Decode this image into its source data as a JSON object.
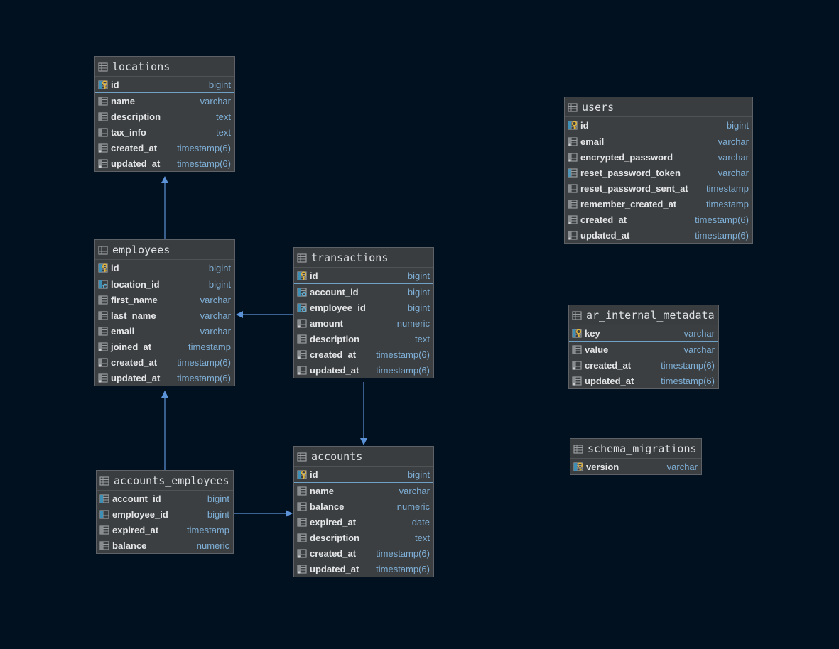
{
  "tables": [
    {
      "key": "locations",
      "name": "locations",
      "columns": [
        {
          "name": "id",
          "type": "bigint",
          "kind": "pk"
        },
        {
          "name": "name",
          "type": "varchar",
          "kind": "col"
        },
        {
          "name": "description",
          "type": "text",
          "kind": "col"
        },
        {
          "name": "tax_info",
          "type": "text",
          "kind": "col"
        },
        {
          "name": "created_at",
          "type": "timestamp(6)",
          "kind": "notnull"
        },
        {
          "name": "updated_at",
          "type": "timestamp(6)",
          "kind": "notnull"
        }
      ]
    },
    {
      "key": "employees",
      "name": "employees",
      "columns": [
        {
          "name": "id",
          "type": "bigint",
          "kind": "pk"
        },
        {
          "name": "location_id",
          "type": "bigint",
          "kind": "fk"
        },
        {
          "name": "first_name",
          "type": "varchar",
          "kind": "col"
        },
        {
          "name": "last_name",
          "type": "varchar",
          "kind": "col"
        },
        {
          "name": "email",
          "type": "varchar",
          "kind": "col"
        },
        {
          "name": "joined_at",
          "type": "timestamp",
          "kind": "notnull"
        },
        {
          "name": "created_at",
          "type": "timestamp(6)",
          "kind": "notnull"
        },
        {
          "name": "updated_at",
          "type": "timestamp(6)",
          "kind": "notnull"
        }
      ]
    },
    {
      "key": "transactions",
      "name": "transactions",
      "columns": [
        {
          "name": "id",
          "type": "bigint",
          "kind": "pk"
        },
        {
          "name": "account_id",
          "type": "bigint",
          "kind": "fk"
        },
        {
          "name": "employee_id",
          "type": "bigint",
          "kind": "fk"
        },
        {
          "name": "amount",
          "type": "numeric",
          "kind": "notnull"
        },
        {
          "name": "description",
          "type": "text",
          "kind": "col"
        },
        {
          "name": "created_at",
          "type": "timestamp(6)",
          "kind": "notnull"
        },
        {
          "name": "updated_at",
          "type": "timestamp(6)",
          "kind": "notnull"
        }
      ]
    },
    {
      "key": "accounts_employees",
      "name": "accounts_employees",
      "columns": [
        {
          "name": "account_id",
          "type": "bigint",
          "kind": "fkonly"
        },
        {
          "name": "employee_id",
          "type": "bigint",
          "kind": "fkonly"
        },
        {
          "name": "expired_at",
          "type": "timestamp",
          "kind": "col"
        },
        {
          "name": "balance",
          "type": "numeric",
          "kind": "col"
        }
      ]
    },
    {
      "key": "accounts",
      "name": "accounts",
      "columns": [
        {
          "name": "id",
          "type": "bigint",
          "kind": "pk"
        },
        {
          "name": "name",
          "type": "varchar",
          "kind": "col"
        },
        {
          "name": "balance",
          "type": "numeric",
          "kind": "col"
        },
        {
          "name": "expired_at",
          "type": "date",
          "kind": "col"
        },
        {
          "name": "description",
          "type": "text",
          "kind": "col"
        },
        {
          "name": "created_at",
          "type": "timestamp(6)",
          "kind": "notnull"
        },
        {
          "name": "updated_at",
          "type": "timestamp(6)",
          "kind": "notnull"
        }
      ]
    },
    {
      "key": "users",
      "name": "users",
      "columns": [
        {
          "name": "id",
          "type": "bigint",
          "kind": "pk"
        },
        {
          "name": "email",
          "type": "varchar",
          "kind": "notnull"
        },
        {
          "name": "encrypted_password",
          "type": "varchar",
          "kind": "notnull"
        },
        {
          "name": "reset_password_token",
          "type": "varchar",
          "kind": "index"
        },
        {
          "name": "reset_password_sent_at",
          "type": "timestamp",
          "kind": "col"
        },
        {
          "name": "remember_created_at",
          "type": "timestamp",
          "kind": "col"
        },
        {
          "name": "created_at",
          "type": "timestamp(6)",
          "kind": "notnull"
        },
        {
          "name": "updated_at",
          "type": "timestamp(6)",
          "kind": "notnull"
        }
      ]
    },
    {
      "key": "ar_internal_metadata",
      "name": "ar_internal_metadata",
      "columns": [
        {
          "name": "key",
          "type": "varchar",
          "kind": "pk"
        },
        {
          "name": "value",
          "type": "varchar",
          "kind": "col"
        },
        {
          "name": "created_at",
          "type": "timestamp(6)",
          "kind": "notnull"
        },
        {
          "name": "updated_at",
          "type": "timestamp(6)",
          "kind": "notnull"
        }
      ]
    },
    {
      "key": "schema_migrations",
      "name": "schema_migrations",
      "columns": [
        {
          "name": "version",
          "type": "varchar",
          "kind": "pkonly"
        }
      ]
    }
  ],
  "relations": [
    {
      "from": "employees",
      "to": "locations",
      "column": "location_id"
    },
    {
      "from": "transactions",
      "to": "employees",
      "column": "employee_id"
    },
    {
      "from": "transactions",
      "to": "accounts",
      "column": "account_id"
    },
    {
      "from": "accounts_employees",
      "to": "employees",
      "column": "employee_id"
    },
    {
      "from": "accounts_employees",
      "to": "accounts",
      "column": "account_id"
    }
  ],
  "colors": {
    "background": "#02111f",
    "relation_line": "#5c93d8",
    "type_text": "#7fb0d8",
    "pk_divider": "#6fa0c6"
  }
}
